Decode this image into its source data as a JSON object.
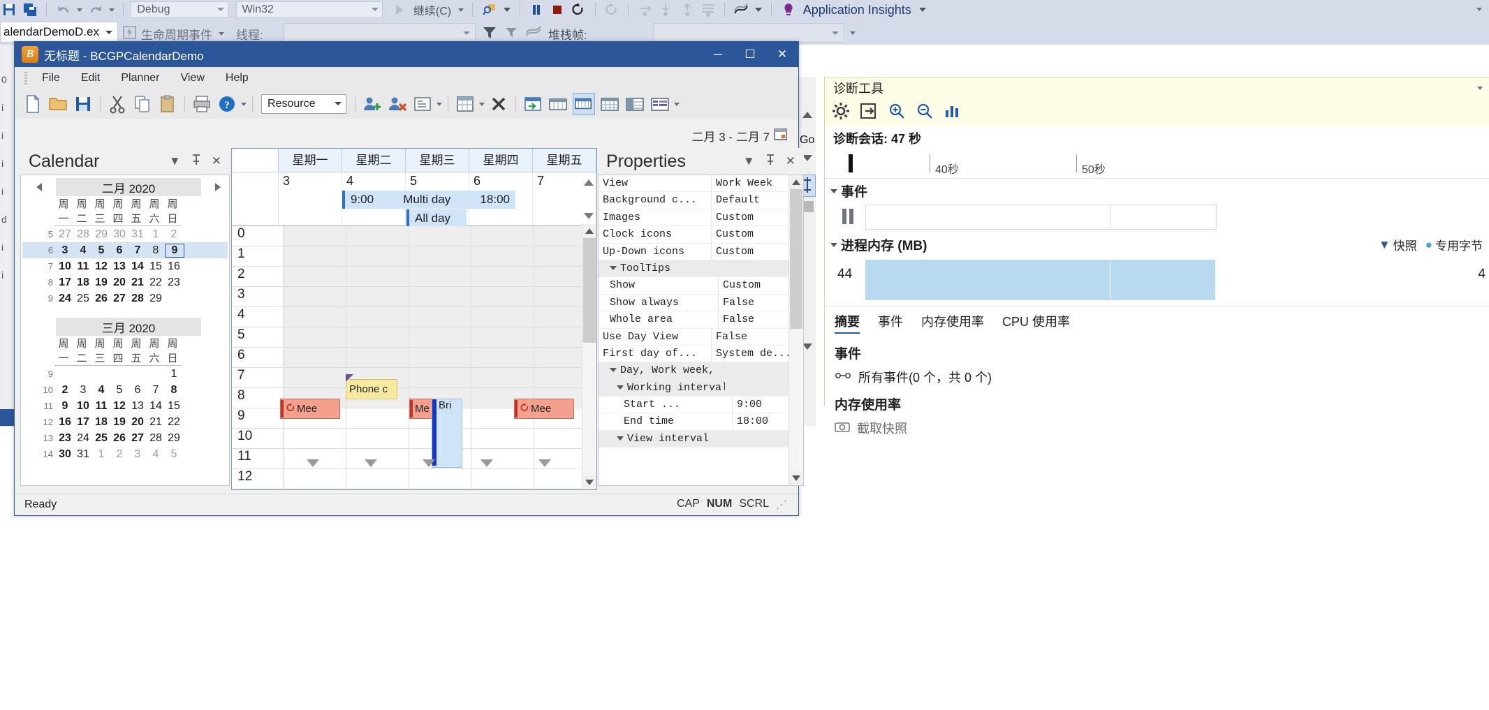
{
  "vs": {
    "toolbar1": {
      "config_label": "Debug",
      "platform_label": "Win32",
      "continue_label": "继续(C)",
      "app_insights_label": "Application Insights",
      "icons": [
        "save-icon",
        "save-all-icon",
        "undo-icon",
        "redo-icon",
        "start-debug-icon",
        "find-icon",
        "break-all-icon",
        "stop-debug-icon",
        "restart-icon",
        "refresh-icon",
        "step-over-icon",
        "step-into-icon",
        "step-out-icon",
        "show-next-statement-icon",
        "threads-icon",
        "lightbulb-icon"
      ]
    },
    "toolbar2": {
      "process_label": "alendarDemoD.ex",
      "lifecycle_label": "生命周期事件",
      "thread_label": "线程:",
      "stackframe_label": "堆栈帧:"
    }
  },
  "app": {
    "title": "无标题 - BCGPCalendarDemo",
    "logo_letter": "B",
    "window_buttons": {
      "minimize": "─",
      "maximize": "☐",
      "close": "✕"
    },
    "menu": [
      "File",
      "Edit",
      "Planner",
      "View",
      "Help"
    ],
    "toolbar": {
      "resource_combo": "Resource",
      "icons": [
        "new-icon",
        "open-icon",
        "save-icon",
        "cut-icon",
        "copy-icon",
        "paste-icon",
        "print-icon",
        "help-icon",
        "add-user-icon",
        "delete-user-icon",
        "properties-icon",
        "day-view-icon",
        "delete-icon",
        "goto-today-icon",
        "work-week-icon",
        "week-view-icon",
        "month-view-icon",
        "timeline-icon",
        "multi-day-icon"
      ]
    },
    "date_range": "二月 3 - 二月 7",
    "status": {
      "ready": "Ready",
      "cap": "CAP",
      "num": "NUM",
      "scrl": "SCRL"
    }
  },
  "calendar_pane": {
    "title": "Calendar",
    "buttons": {
      "dropdown": "▼",
      "pin": "⚲",
      "close": "✕"
    },
    "months": [
      {
        "name": "二月 2020",
        "dows": [
          "周一",
          "周二",
          "周三",
          "周四",
          "周五",
          "周六",
          "周日"
        ],
        "weeks": [
          {
            "wk": "5",
            "days": [
              "27",
              "28",
              "29",
              "30",
              "31",
              "1",
              "2"
            ],
            "out": [
              true,
              true,
              true,
              true,
              true,
              true,
              true
            ],
            "bold": [
              false,
              false,
              false,
              false,
              false,
              false,
              false
            ],
            "selected": false,
            "today_index": -1
          },
          {
            "wk": "6",
            "days": [
              "3",
              "4",
              "5",
              "6",
              "7",
              "8",
              "9"
            ],
            "out": [
              false,
              false,
              false,
              false,
              false,
              false,
              false
            ],
            "bold": [
              true,
              true,
              true,
              true,
              true,
              false,
              true
            ],
            "selected": true,
            "today_index": 6
          },
          {
            "wk": "7",
            "days": [
              "10",
              "11",
              "12",
              "13",
              "14",
              "15",
              "16"
            ],
            "out": [
              false,
              false,
              false,
              false,
              false,
              false,
              false
            ],
            "bold": [
              true,
              true,
              true,
              true,
              true,
              false,
              false
            ],
            "selected": false,
            "today_index": -1
          },
          {
            "wk": "8",
            "days": [
              "17",
              "18",
              "19",
              "20",
              "21",
              "22",
              "23"
            ],
            "out": [
              false,
              false,
              false,
              false,
              false,
              false,
              false
            ],
            "bold": [
              true,
              true,
              true,
              true,
              true,
              false,
              false
            ],
            "selected": false,
            "today_index": -1
          },
          {
            "wk": "9",
            "days": [
              "24",
              "25",
              "26",
              "27",
              "28",
              "29",
              ""
            ],
            "out": [
              false,
              false,
              false,
              false,
              false,
              false,
              false
            ],
            "bold": [
              true,
              false,
              true,
              true,
              true,
              false,
              false
            ],
            "selected": false,
            "today_index": -1
          }
        ]
      },
      {
        "name": "三月 2020",
        "dows": [
          "周一",
          "周二",
          "周三",
          "周四",
          "周五",
          "周六",
          "周日"
        ],
        "weeks": [
          {
            "wk": "9",
            "days": [
              "",
              "",
              "",
              "",
              "",
              "",
              "1"
            ],
            "out": [
              false,
              false,
              false,
              false,
              false,
              false,
              false
            ],
            "bold": [
              false,
              false,
              false,
              false,
              false,
              false,
              false
            ],
            "selected": false,
            "today_index": -1
          },
          {
            "wk": "10",
            "days": [
              "2",
              "3",
              "4",
              "5",
              "6",
              "7",
              "8"
            ],
            "out": [
              false,
              false,
              false,
              false,
              false,
              false,
              false
            ],
            "bold": [
              true,
              false,
              true,
              false,
              false,
              false,
              true
            ],
            "selected": false,
            "today_index": -1
          },
          {
            "wk": "11",
            "days": [
              "9",
              "10",
              "11",
              "12",
              "13",
              "14",
              "15"
            ],
            "out": [
              false,
              false,
              false,
              false,
              false,
              false,
              false
            ],
            "bold": [
              true,
              true,
              true,
              true,
              false,
              false,
              false
            ],
            "selected": false,
            "today_index": -1
          },
          {
            "wk": "12",
            "days": [
              "16",
              "17",
              "18",
              "19",
              "20",
              "21",
              "22"
            ],
            "out": [
              false,
              false,
              false,
              false,
              false,
              false,
              false
            ],
            "bold": [
              true,
              true,
              true,
              true,
              true,
              false,
              false
            ],
            "selected": false,
            "today_index": -1
          },
          {
            "wk": "13",
            "days": [
              "23",
              "24",
              "25",
              "26",
              "27",
              "28",
              "29"
            ],
            "out": [
              false,
              false,
              false,
              false,
              false,
              false,
              false
            ],
            "bold": [
              true,
              false,
              true,
              true,
              true,
              false,
              false
            ],
            "selected": false,
            "today_index": -1
          },
          {
            "wk": "14",
            "days": [
              "30",
              "31",
              "1",
              "2",
              "3",
              "4",
              "5"
            ],
            "out": [
              false,
              false,
              true,
              true,
              true,
              true,
              true
            ],
            "bold": [
              true,
              false,
              false,
              false,
              false,
              false,
              false
            ],
            "selected": false,
            "today_index": -1
          }
        ]
      }
    ]
  },
  "planner": {
    "day_headers": [
      "星期一",
      "星期二",
      "星期三",
      "星期四",
      "星期五"
    ],
    "day_numbers": [
      "3",
      "4",
      "5",
      "6",
      "7"
    ],
    "allday_events": [
      {
        "label_left": "9:00",
        "label_mid": "Multi day",
        "label_right": "18:00",
        "color": "#cfe4f7"
      },
      {
        "label_mid": "All day",
        "color": "#cfe4f7"
      }
    ],
    "time_labels": [
      "0",
      "1",
      "2",
      "3",
      "4",
      "5",
      "6",
      "7",
      "8",
      "9",
      "10",
      "11",
      "12"
    ],
    "appointments": [
      {
        "text": "Phone c",
        "day": 1,
        "color": "#f7e9a0",
        "border": "#c9b960"
      },
      {
        "text": "Mee",
        "day": 0,
        "color": "#f4a08f",
        "border": "#c76a5c",
        "icon": "recurrence-icon"
      },
      {
        "text": "Me",
        "day": 2,
        "color": "#f4a08f",
        "border": "#c76a5c"
      },
      {
        "text": "Bri",
        "day": 2,
        "color": "#cfe4f7",
        "border": "#2244cc"
      },
      {
        "text": "Mee",
        "day": 4,
        "color": "#f4a08f",
        "border": "#c76a5c",
        "icon": "recurrence-icon"
      }
    ]
  },
  "properties_pane": {
    "title": "Properties",
    "buttons": {
      "dropdown": "▼",
      "pin": "⚲",
      "close": "✕"
    },
    "rows": [
      {
        "name": "View",
        "value": "Work Week",
        "indent": 0,
        "category": false
      },
      {
        "name": "Background c...",
        "value": "Default",
        "indent": 0,
        "category": false
      },
      {
        "name": "Images",
        "value": "Custom",
        "indent": 0,
        "category": false
      },
      {
        "name": "Clock icons",
        "value": "Custom",
        "indent": 0,
        "category": false
      },
      {
        "name": "Up-Down icons",
        "value": "Custom",
        "indent": 0,
        "category": false
      },
      {
        "name": "ToolTips",
        "value": "",
        "indent": 1,
        "category": true
      },
      {
        "name": "Show",
        "value": "Custom",
        "indent": 1,
        "category": false
      },
      {
        "name": "Show always",
        "value": "False",
        "indent": 1,
        "category": false
      },
      {
        "name": "Whole area",
        "value": "False",
        "indent": 1,
        "category": false
      },
      {
        "name": "Use Day View",
        "value": "False",
        "indent": 0,
        "category": false
      },
      {
        "name": "First day of...",
        "value": "System de...",
        "indent": 0,
        "category": false
      },
      {
        "name": "Day, Work week, Multi...",
        "value": "",
        "indent": 1,
        "category": true
      },
      {
        "name": "Working interval",
        "value": "",
        "indent": 2,
        "category": true
      },
      {
        "name": "Start ...",
        "value": "9:00",
        "indent": 3,
        "category": false
      },
      {
        "name": "End time",
        "value": "18:00",
        "indent": 3,
        "category": false
      },
      {
        "name": "View interval",
        "value": "",
        "indent": 2,
        "category": true
      }
    ]
  },
  "diagnostics": {
    "title": "诊断工具",
    "toolbar_icons": [
      "settings-icon",
      "export-icon",
      "zoom-in-icon",
      "zoom-out-icon",
      "chart-icon"
    ],
    "session_label": "诊断会话: 47 秒",
    "ruler_ticks": [
      "40秒",
      "50秒"
    ],
    "events_section": {
      "title": "事件"
    },
    "memory_section": {
      "title": "进程内存 (MB)",
      "value": "44",
      "right_value": "4",
      "legend": [
        {
          "label": "快照",
          "marker": "▼",
          "color": "#2b579a"
        },
        {
          "label": "专用字节",
          "marker": "●",
          "color": "#4a9fd8"
        }
      ]
    },
    "tabs": [
      {
        "label": "摘要",
        "active": true
      },
      {
        "label": "事件",
        "active": false
      },
      {
        "label": "内存使用率",
        "active": false
      },
      {
        "label": "CPU 使用率",
        "active": false
      }
    ],
    "events_header": "事件",
    "events_row": "所有事件(0 个，共 0 个)",
    "memory_header": "内存使用率",
    "memory_row": "截取快照"
  },
  "go_button": "Go"
}
